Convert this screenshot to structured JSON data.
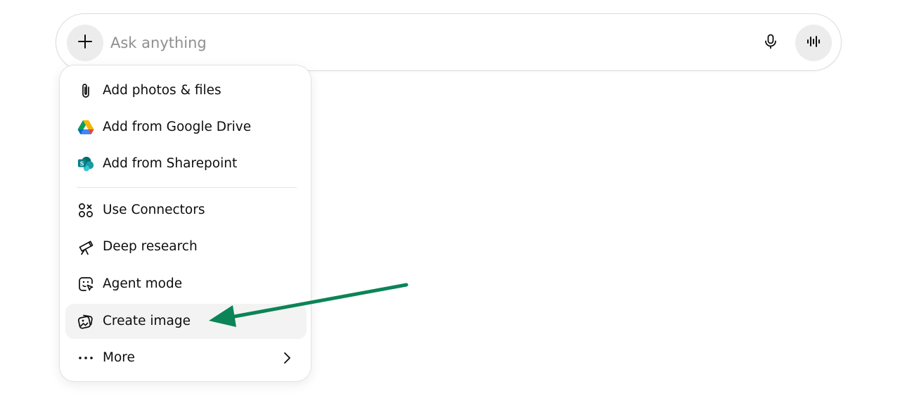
{
  "composer": {
    "placeholder": "Ask anything",
    "value": "",
    "plus_icon": "plus-icon",
    "mic_icon": "microphone-icon",
    "voice_icon": "voice-waveform-icon"
  },
  "menu": {
    "items": [
      {
        "label": "Add photos & files",
        "icon": "paperclip-icon"
      },
      {
        "label": "Add from Google Drive",
        "icon": "google-drive-icon"
      },
      {
        "label": "Add from Sharepoint",
        "icon": "sharepoint-icon"
      },
      {
        "label": "Use Connectors",
        "icon": "connectors-icon"
      },
      {
        "label": "Deep research",
        "icon": "telescope-icon"
      },
      {
        "label": "Agent mode",
        "icon": "agent-cursor-icon"
      },
      {
        "label": "Create image",
        "icon": "image-icon",
        "highlighted": true
      },
      {
        "label": "More",
        "icon": "more-dots-icon",
        "has_submenu": true
      }
    ]
  },
  "annotation": {
    "arrow_color": "#0b8457",
    "points_to": "Create image"
  },
  "colors": {
    "google_drive_green": "#0f9d58",
    "google_drive_yellow": "#f4b400",
    "google_drive_blue": "#4285f4",
    "sharepoint_teal": "#038387"
  }
}
